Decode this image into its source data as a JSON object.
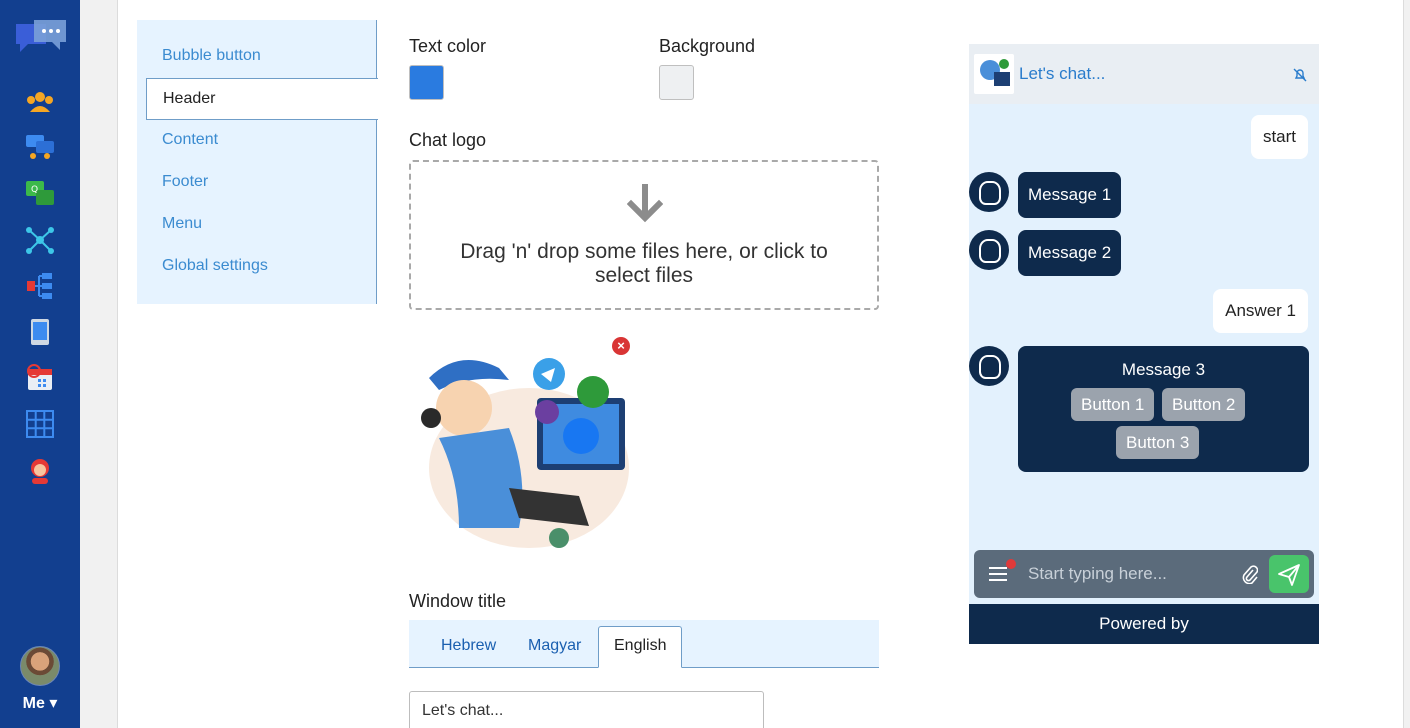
{
  "rail": {
    "icons": [
      "team-icon",
      "chat-users-icon",
      "qa-icon",
      "network-icon",
      "flow-icon",
      "tablet-icon",
      "calendar-icon",
      "grid-icon",
      "user-support-icon"
    ],
    "me_label": "Me ▾"
  },
  "menu": {
    "items": [
      "Bubble button",
      "Header",
      "Content",
      "Footer",
      "Menu",
      "Global settings"
    ],
    "active": "Header"
  },
  "form": {
    "text_color_label": "Text color",
    "text_color_value": "#2a7be0",
    "background_label": "Background",
    "background_value": "#eef0f2",
    "chat_logo_label": "Chat logo",
    "dropzone_text": "Drag 'n' drop some files here, or click to select files",
    "remove_symbol": "×",
    "window_title_label": "Window title",
    "languages": [
      "Hebrew",
      "Magyar",
      "English"
    ],
    "active_language": "English",
    "window_title_value": "Let's chat..."
  },
  "chat": {
    "title": "Let's chat...",
    "user_message_1": "start",
    "bot_message_1": "Message 1",
    "bot_message_2": "Message 2",
    "user_message_2": "Answer 1",
    "card_title": "Message 3",
    "buttons": [
      "Button 1",
      "Button 2",
      "Button 3"
    ],
    "input_placeholder": "Start typing here...",
    "powered_by": "Powered by"
  }
}
